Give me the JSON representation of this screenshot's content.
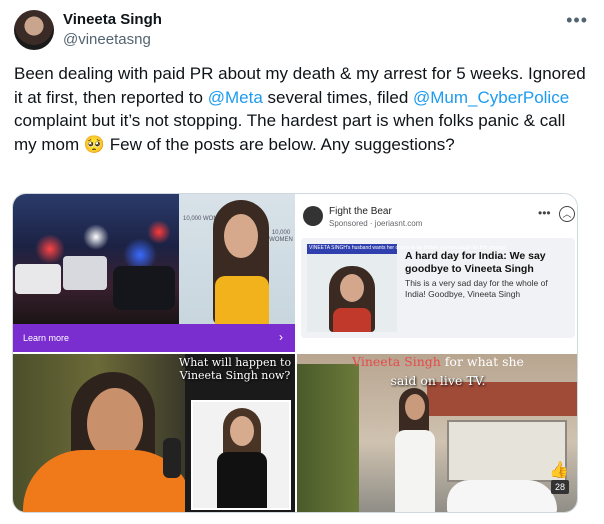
{
  "tweet": {
    "author_name": "Vineeta Singh",
    "author_handle": "@vineetasng",
    "more_icon": "more-horizontal-icon",
    "text_parts": {
      "p1": "Been dealing with paid PR about my death & my arrest for 5 weeks. Ignored it at first, then reported to ",
      "mention1": "@Meta",
      "p2": " several times, filed ",
      "mention2": "@Mum_CyberPolice",
      "p3": " complaint but it’s not stopping. The hardest part is when folks panic & call my mom ",
      "emoji": "🥺",
      "p4": " Few of the posts are below. Any suggestions?"
    },
    "link_color": "#1d9bf0"
  },
  "media": {
    "tile1": {
      "badge_text": "10,000 WOMEN",
      "cta_label": "Learn more",
      "cta_icon": "chevron-right-icon",
      "accent": "#7b2ecf"
    },
    "tile2": {
      "page_name": "Fight the Bear",
      "sponsored": "Sponsored · joeriasnt.com",
      "headline": "A hard day for India: We say goodbye to Vineeta Singh",
      "description": "This is a very sad day for the whole of India! Goodbye, Vineeta Singh",
      "image_caption": "VINEETA SINGH's husband wants her drama to be thrown out now much for this storage"
    },
    "tile3": {
      "caption": "What will happen to Vineeta Singh now?"
    },
    "tile4": {
      "caption_red": "Vineeta Singh",
      "caption_rest": " for what she",
      "caption_line2": "said on live TV.",
      "like_icon": "thumbs-up-icon",
      "count": "28"
    }
  }
}
